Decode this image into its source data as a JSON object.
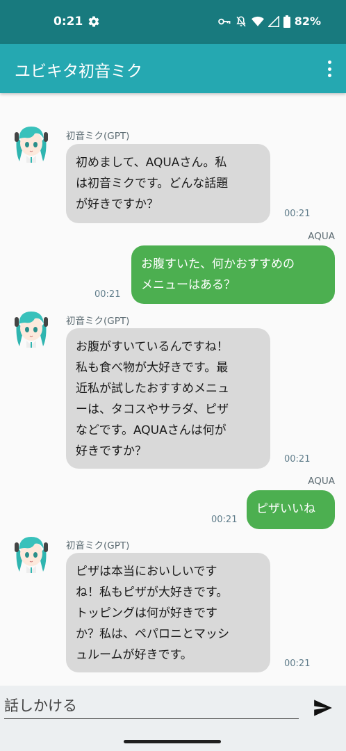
{
  "status_bar": {
    "time": "0:21",
    "battery": "82%",
    "icons": [
      "settings-icon",
      "vpn-key-icon",
      "mute-icon",
      "wifi-icon",
      "signal-icon",
      "battery-icon"
    ]
  },
  "app_bar": {
    "title": "ユビキタ初音ミク",
    "menu_icon": "more-vert-icon"
  },
  "messages": [
    {
      "sender": "初音ミク(GPT)",
      "role": "bot",
      "lines": [
        "初めまして、AQUAさん。私",
        "は初音ミクです。どんな話題",
        "が好きですか？"
      ],
      "time": "00:21"
    },
    {
      "sender": "AQUA",
      "role": "user",
      "lines": [
        "お腹すいた、何かおすすめの",
        "メニューはある？"
      ],
      "time": "00:21"
    },
    {
      "sender": "初音ミク(GPT)",
      "role": "bot",
      "lines": [
        "お腹がすいているんですね！",
        "私も食べ物が大好きです。最",
        "近私が試したおすすめメニュ",
        "ーは、タコスやサラダ、ピザ",
        "などです。AQUAさんは何が",
        "好きですか？"
      ],
      "time": "00:21"
    },
    {
      "sender": "AQUA",
      "role": "user",
      "lines": [
        "ピザいいね"
      ],
      "time": "00:21"
    },
    {
      "sender": "初音ミク(GPT)",
      "role": "bot",
      "lines": [
        "ピザは本当においしいです",
        "ね！私もピザが大好きです。",
        "トッピングは何が好きです",
        "か？私は、ペパロニとマッシ",
        "ュルームが好きです。"
      ],
      "time": "00:21"
    }
  ],
  "input": {
    "placeholder": "話しかける",
    "value": ""
  },
  "send_icon": "send-icon",
  "colors": {
    "status_bar": "#187a7e",
    "app_bar": "#25a8b1",
    "bot_bubble": "#d9d9d9",
    "user_bubble": "#4caf50",
    "time_text": "#607d8b"
  }
}
